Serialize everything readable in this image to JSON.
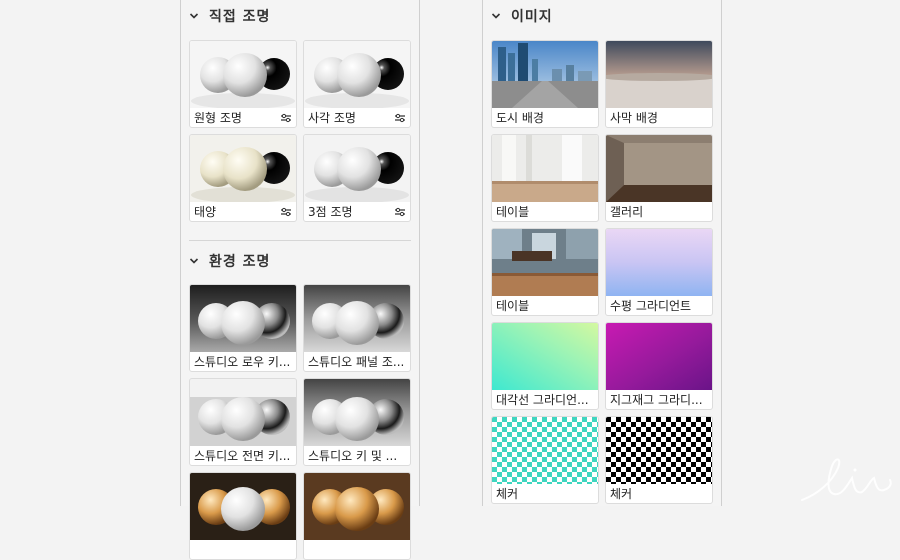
{
  "left_panel": {
    "direct_lighting": {
      "title": "직접 조명",
      "items": [
        {
          "label": "원형 조명"
        },
        {
          "label": "사각 조명"
        },
        {
          "label": "태양"
        },
        {
          "label": "3점 조명"
        }
      ]
    },
    "environment_lighting": {
      "title": "환경 조명",
      "items": [
        {
          "label": "스튜디오 로우 키..."
        },
        {
          "label": "스튜디오 패널 조..."
        },
        {
          "label": "스튜디오 전면 키..."
        },
        {
          "label": "스튜디오 키 및 ..."
        }
      ]
    }
  },
  "right_panel": {
    "images": {
      "title": "이미지",
      "items": [
        {
          "label": "도시 배경"
        },
        {
          "label": "사막 배경"
        },
        {
          "label": "테이블"
        },
        {
          "label": "갤러리"
        },
        {
          "label": "테이블"
        },
        {
          "label": "수평 그라디언트"
        },
        {
          "label": "대각선 그라디언..."
        },
        {
          "label": "지그재그 그라디..."
        },
        {
          "label": "체커"
        },
        {
          "label": "체커"
        }
      ]
    }
  },
  "icons": {
    "chevron": "chevron-down-icon",
    "adjust": "sliders-icon"
  },
  "colors": {
    "panel_bg": "#f4f4f4",
    "card_border": "#dcdcdc",
    "checker_teal": "#3fd6c0",
    "checker_black": "#000000",
    "gradient_purple": "#a020a0"
  }
}
